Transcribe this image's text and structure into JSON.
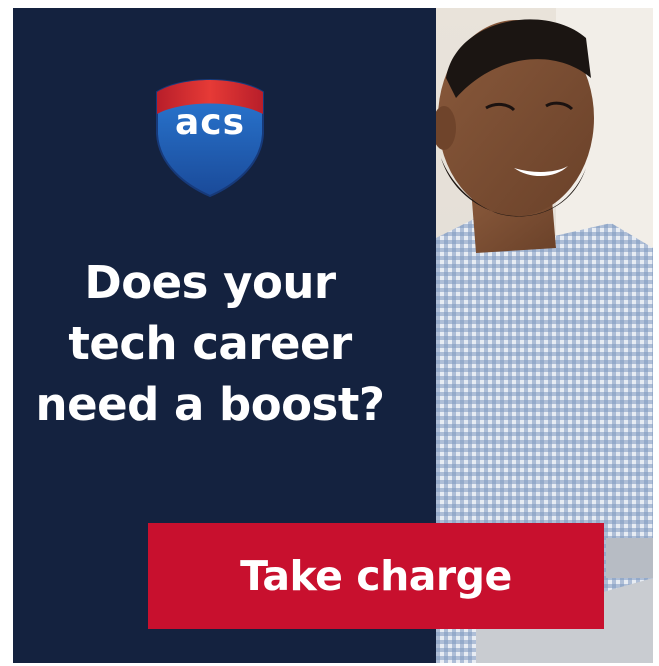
{
  "ad": {
    "logo_text": "acs",
    "headline": [
      "Does your",
      "tech career",
      "need a boost?"
    ],
    "cta_label": "Take charge"
  },
  "colors": {
    "navy": "#14223f",
    "cta_red": "#c8102e",
    "logo_blue": "#1f5fb8",
    "logo_red": "#d7282f",
    "text": "#ffffff"
  },
  "icons": {
    "logo": "acs-shield-logo"
  }
}
